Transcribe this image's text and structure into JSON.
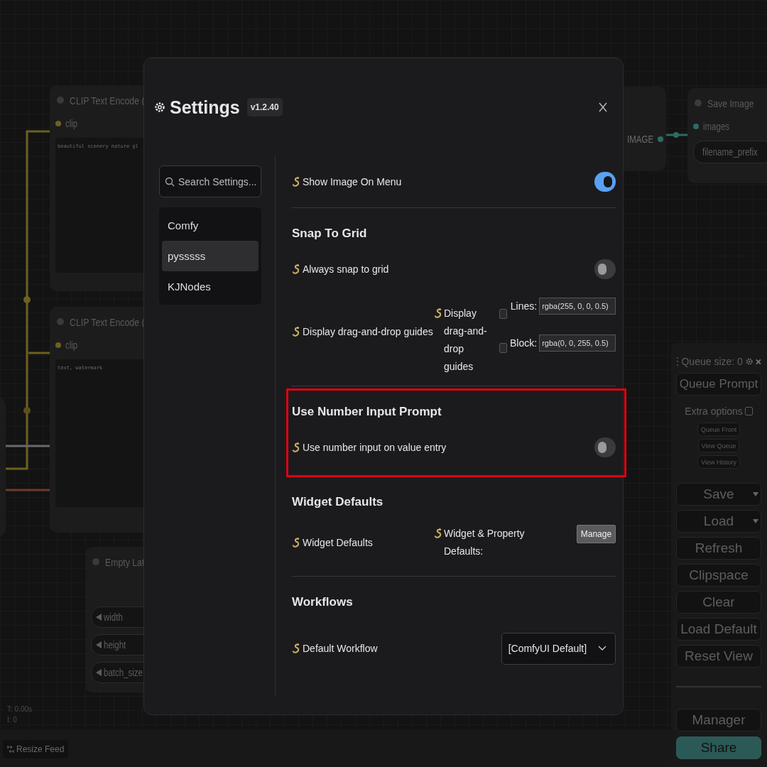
{
  "canvas": {
    "nodes": [
      {
        "kind": "text_encode",
        "title": "CLIP Text Encode (",
        "input": "clip",
        "text": "beautiful scenery nature gl"
      },
      {
        "kind": "text_encode",
        "title": "CLIP Text Encode (",
        "input": "clip",
        "text": "text, watermark"
      },
      {
        "kind": "latent",
        "title": "Empty Lat",
        "widgets": [
          "width",
          "height",
          "batch_size"
        ]
      },
      {
        "kind": "output",
        "output": "IMAGE"
      },
      {
        "kind": "save",
        "title": "Save Image",
        "input": "images",
        "widgets": [
          "filename_prefix"
        ]
      }
    ],
    "stats": [
      "T: 0.00s",
      "I: 0"
    ]
  },
  "dialog": {
    "title": "Settings",
    "version": "v1.2.40",
    "search": {
      "placeholder": "Search Settings..."
    },
    "categories": [
      {
        "label": "Comfy",
        "selected": false
      },
      {
        "label": "pysssss",
        "selected": true
      },
      {
        "label": "KJNodes",
        "selected": false
      }
    ],
    "sections": [
      {
        "highlighted": false,
        "rows": [
          {
            "kind": "toggle",
            "label": "Show Image On Menu",
            "on": true
          }
        ]
      },
      {
        "title": "Snap To Grid",
        "highlighted": false,
        "rows": [
          {
            "kind": "toggle",
            "label": "Always snap to grid",
            "on": false
          },
          {
            "kind": "guides",
            "label": "Display drag-and-drop guides",
            "sublabel": "Display drag-and-drop guides",
            "checks": [
              {
                "checked": false
              },
              {
                "checked": false
              }
            ],
            "inputs": [
              {
                "label": "Lines:",
                "value": "rgba(255, 0, 0, 0.5)"
              },
              {
                "label": "Block:",
                "value": "rgba(0, 0, 255, 0.5)"
              }
            ]
          }
        ]
      },
      {
        "title": "Use Number Input Prompt",
        "highlighted": true,
        "rows": [
          {
            "kind": "toggle",
            "label": "Use number input on value entry",
            "on": false
          }
        ]
      },
      {
        "title": "Widget Defaults",
        "highlighted": false,
        "rows": [
          {
            "kind": "button",
            "label": "Widget Defaults",
            "sublabel": "Widget & Property Defaults:",
            "button": "Manage"
          }
        ]
      },
      {
        "title": "Workflows",
        "highlighted": false,
        "rows": [
          {
            "kind": "select",
            "label": "Default Workflow",
            "value": "[ComfyUI Default]"
          }
        ]
      }
    ]
  },
  "queue_panel": {
    "title": "Queue size: 0",
    "primary": "Queue Prompt",
    "extra_options": {
      "label": "Extra options",
      "checked": false
    },
    "small_buttons": [
      "Queue Front",
      "View Queue",
      "View History"
    ],
    "buttons": [
      {
        "label": "Save",
        "dropdown": true
      },
      {
        "label": "Load",
        "dropdown": true
      },
      {
        "label": "Refresh",
        "dropdown": false
      },
      {
        "label": "Clipspace",
        "dropdown": false
      },
      {
        "label": "Clear",
        "dropdown": false
      },
      {
        "label": "Load Default",
        "dropdown": false
      },
      {
        "label": "Reset View",
        "dropdown": false
      }
    ],
    "footer_buttons": [
      {
        "label": "Manager",
        "kind": "plain"
      },
      {
        "label": "Share",
        "kind": "accent"
      }
    ]
  },
  "bottom_bar": {
    "button": "Resize Feed"
  }
}
